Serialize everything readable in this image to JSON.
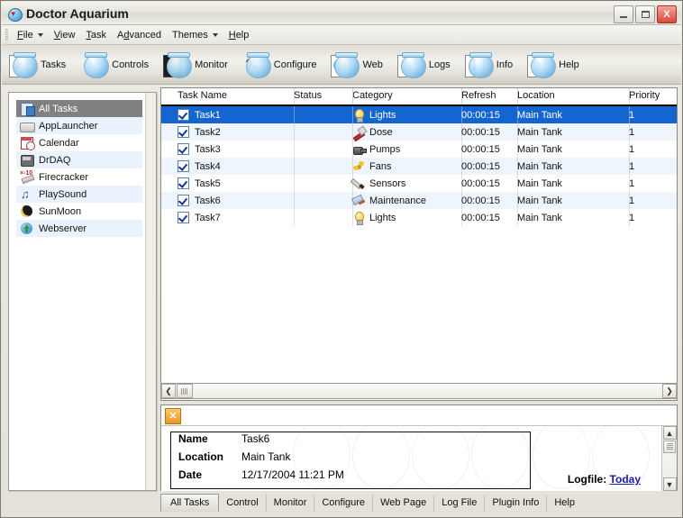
{
  "window": {
    "title": "Doctor Aquarium",
    "app_icon": "fishbowl-heart-icon",
    "minimize_label": "Minimize",
    "maximize_label": "Maximize",
    "close_label": "X"
  },
  "menubar": {
    "items": [
      {
        "label": "File",
        "accel": "F",
        "has_dropdown": true
      },
      {
        "label": "View",
        "accel": "V",
        "has_dropdown": false
      },
      {
        "label": "Task",
        "accel": "T",
        "has_dropdown": false
      },
      {
        "label": "Advanced",
        "accel": "d",
        "has_dropdown": false
      },
      {
        "label": "Themes",
        "accel": "",
        "has_dropdown": true
      },
      {
        "label": "Help",
        "accel": "H",
        "has_dropdown": false
      }
    ]
  },
  "toolbar": {
    "buttons": [
      {
        "label": "Tasks",
        "icon": "checklist-icon",
        "glyph": "✓"
      },
      {
        "label": "Controls",
        "icon": "controls-icon",
        "glyph": "☸"
      },
      {
        "label": "Monitor",
        "icon": "monitor-graph-icon",
        "glyph": "∿"
      },
      {
        "label": "Configure",
        "icon": "tools-icon",
        "glyph": "⚒"
      },
      {
        "label": "Web",
        "icon": "globe-page-icon",
        "glyph": "ἱ0"
      },
      {
        "label": "Logs",
        "icon": "log-page-icon",
        "glyph": "∿"
      },
      {
        "label": "Info",
        "icon": "info-icon",
        "glyph": "i"
      },
      {
        "label": "Help",
        "icon": "help-question-icon",
        "glyph": "?"
      }
    ]
  },
  "sidebar": {
    "items": [
      {
        "label": "All Tasks",
        "icon": "all-tasks-icon",
        "selected": true
      },
      {
        "label": "AppLauncher",
        "icon": "folder-icon",
        "selected": false
      },
      {
        "label": "Calendar",
        "icon": "calendar-icon",
        "selected": false
      },
      {
        "label": "DrDAQ",
        "icon": "drdaq-device-icon",
        "selected": false
      },
      {
        "label": "Firecracker",
        "icon": "firecracker-x10-icon",
        "selected": false
      },
      {
        "label": "PlaySound",
        "icon": "music-note-icon",
        "selected": false
      },
      {
        "label": "SunMoon",
        "icon": "sun-moon-icon",
        "selected": false
      },
      {
        "label": "Webserver",
        "icon": "globe-icon",
        "selected": false
      }
    ]
  },
  "task_list": {
    "columns": [
      "Task Name",
      "Status",
      "Category",
      "Refresh",
      "Location",
      "Priority"
    ],
    "rows": [
      {
        "checked": true,
        "name": "Task1",
        "status": "",
        "category": "Lights",
        "cat_icon": "lightbulb-icon",
        "refresh": "00:00:15",
        "location": "Main Tank",
        "priority": "1",
        "selected": true
      },
      {
        "checked": true,
        "name": "Task2",
        "status": "",
        "category": "Dose",
        "cat_icon": "dropper-icon",
        "refresh": "00:00:15",
        "location": "Main Tank",
        "priority": "1",
        "selected": false
      },
      {
        "checked": true,
        "name": "Task3",
        "status": "",
        "category": "Pumps",
        "cat_icon": "pump-icon",
        "refresh": "00:00:15",
        "location": "Main Tank",
        "priority": "1",
        "selected": false
      },
      {
        "checked": true,
        "name": "Task4",
        "status": "",
        "category": "Fans",
        "cat_icon": "fan-icon",
        "refresh": "00:00:15",
        "location": "Main Tank",
        "priority": "1",
        "selected": false
      },
      {
        "checked": true,
        "name": "Task5",
        "status": "",
        "category": "Sensors",
        "cat_icon": "probe-icon",
        "refresh": "00:00:15",
        "location": "Main Tank",
        "priority": "1",
        "selected": false
      },
      {
        "checked": true,
        "name": "Task6",
        "status": "",
        "category": "Maintenance",
        "cat_icon": "squeegee-icon",
        "refresh": "00:00:15",
        "location": "Main Tank",
        "priority": "1",
        "selected": false
      },
      {
        "checked": true,
        "name": "Task7",
        "status": "",
        "category": "Lights",
        "cat_icon": "lightbulb-icon",
        "refresh": "00:00:15",
        "location": "Main Tank",
        "priority": "1",
        "selected": false
      }
    ]
  },
  "detail_panel": {
    "close_button": "✕",
    "name_label": "Name",
    "name_value": "Task6",
    "location_label": "Location",
    "location_value": "Main Tank",
    "date_label": "Date",
    "date_value": "12/17/2004 11:21 PM",
    "logfile_label": "Logfile:",
    "logfile_link": "Today"
  },
  "bottom_tabs": {
    "items": [
      {
        "label": "All Tasks",
        "active": true
      },
      {
        "label": "Control",
        "active": false
      },
      {
        "label": "Monitor",
        "active": false
      },
      {
        "label": "Configure",
        "active": false
      },
      {
        "label": "Web Page",
        "active": false
      },
      {
        "label": "Log File",
        "active": false
      },
      {
        "label": "Plugin Info",
        "active": false
      },
      {
        "label": "Help",
        "active": false
      }
    ]
  },
  "scrollbars": {
    "left_arrow": "❮",
    "right_arrow": "❯",
    "up_arrow": "▲",
    "down_arrow": "▼"
  },
  "colors": {
    "selection_blue": "#1565d0",
    "stripe_blue": "#eef5fd",
    "sidebar_selection": "#808080",
    "link_blue": "#1a1aa8",
    "close_red": "#d84b3c",
    "accent_orange": "#e8941f"
  }
}
